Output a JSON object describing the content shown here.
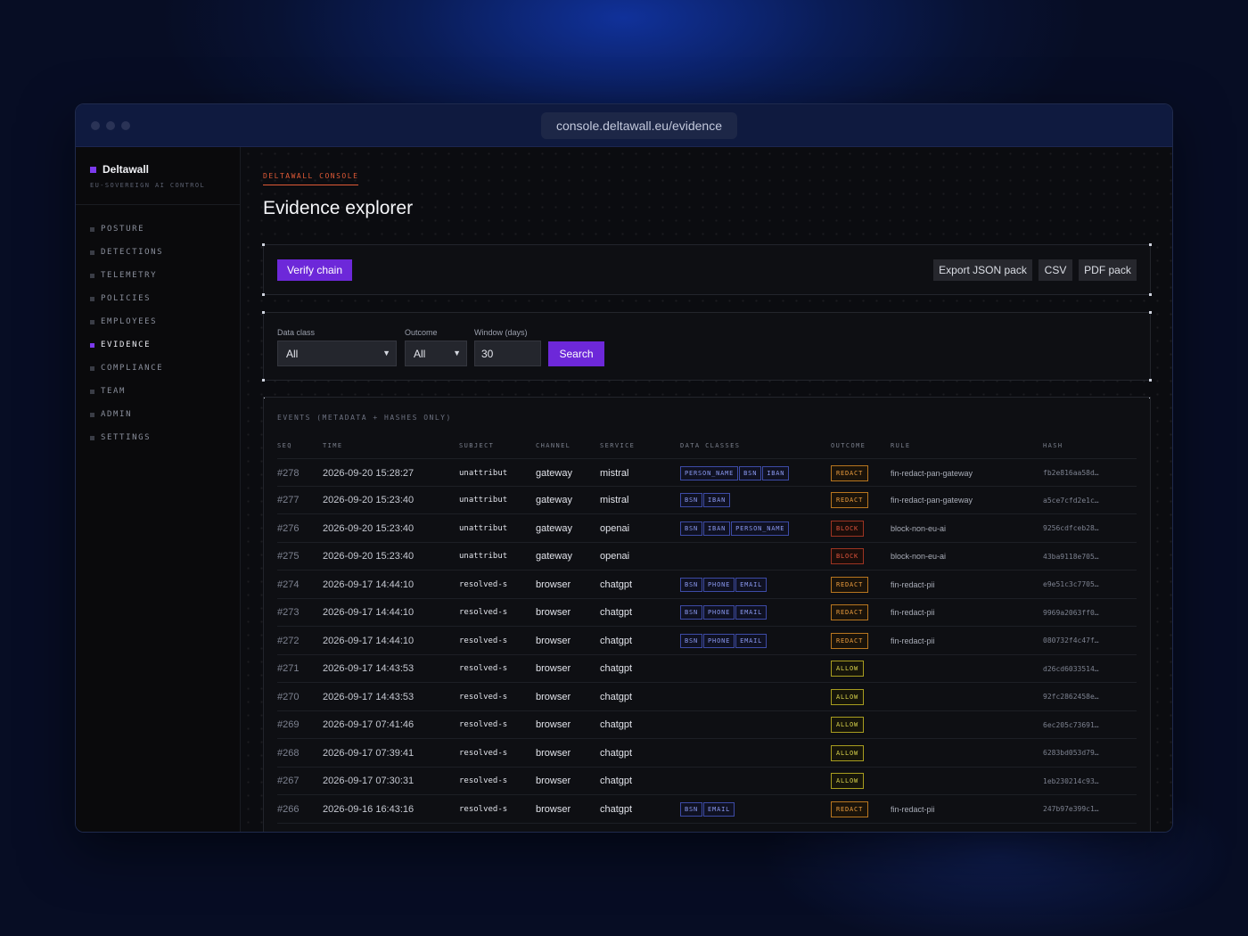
{
  "browser": {
    "url": "console.deltawall.eu/evidence"
  },
  "brand": {
    "name": "Deltawall",
    "tagline": "EU-SOVEREIGN AI CONTROL"
  },
  "nav": [
    {
      "label": "POSTURE",
      "active": false
    },
    {
      "label": "DETECTIONS",
      "active": false
    },
    {
      "label": "TELEMETRY",
      "active": false
    },
    {
      "label": "POLICIES",
      "active": false
    },
    {
      "label": "EMPLOYEES",
      "active": false
    },
    {
      "label": "EVIDENCE",
      "active": true
    },
    {
      "label": "COMPLIANCE",
      "active": false
    },
    {
      "label": "TEAM",
      "active": false
    },
    {
      "label": "ADMIN",
      "active": false
    },
    {
      "label": "SETTINGS",
      "active": false
    }
  ],
  "page": {
    "eyebrow": "DELTAWALL CONSOLE",
    "title": "Evidence explorer"
  },
  "actions": {
    "verify": "Verify chain",
    "export_json": "Export JSON pack",
    "csv": "CSV",
    "pdf": "PDF pack"
  },
  "filters": {
    "data_class": {
      "label": "Data class",
      "value": "All"
    },
    "outcome": {
      "label": "Outcome",
      "value": "All"
    },
    "window": {
      "label": "Window (days)",
      "value": "30"
    },
    "search": "Search"
  },
  "events": {
    "heading": "EVENTS (METADATA + HASHES ONLY)",
    "columns": [
      "SEQ",
      "TIME",
      "SUBJECT",
      "CHANNEL",
      "SERVICE",
      "DATA CLASSES",
      "OUTCOME",
      "RULE",
      "HASH"
    ],
    "rows": [
      {
        "seq": "#278",
        "time": "2026-09-20 15:28:27",
        "subject": "unattribut",
        "channel": "gateway",
        "service": "mistral",
        "classes": [
          "PERSON_NAME",
          "BSN",
          "IBAN"
        ],
        "outcome": "REDACT",
        "rule": "fin-redact-pan-gateway",
        "hash": "fb2e816aa58d…"
      },
      {
        "seq": "#277",
        "time": "2026-09-20 15:23:40",
        "subject": "unattribut",
        "channel": "gateway",
        "service": "mistral",
        "classes": [
          "BSN",
          "IBAN"
        ],
        "outcome": "REDACT",
        "rule": "fin-redact-pan-gateway",
        "hash": "a5ce7cfd2e1c…"
      },
      {
        "seq": "#276",
        "time": "2026-09-20 15:23:40",
        "subject": "unattribut",
        "channel": "gateway",
        "service": "openai",
        "classes": [
          "BSN",
          "IBAN",
          "PERSON_NAME"
        ],
        "outcome": "BLOCK",
        "rule": "block-non-eu-ai",
        "hash": "9256cdfceb28…"
      },
      {
        "seq": "#275",
        "time": "2026-09-20 15:23:40",
        "subject": "unattribut",
        "channel": "gateway",
        "service": "openai",
        "classes": [],
        "outcome": "BLOCK",
        "rule": "block-non-eu-ai",
        "hash": "43ba9118e705…"
      },
      {
        "seq": "#274",
        "time": "2026-09-17 14:44:10",
        "subject": "resolved-s",
        "channel": "browser",
        "service": "chatgpt",
        "classes": [
          "BSN",
          "PHONE",
          "EMAIL"
        ],
        "outcome": "REDACT",
        "rule": "fin-redact-pii",
        "hash": "e9e51c3c7705…"
      },
      {
        "seq": "#273",
        "time": "2026-09-17 14:44:10",
        "subject": "resolved-s",
        "channel": "browser",
        "service": "chatgpt",
        "classes": [
          "BSN",
          "PHONE",
          "EMAIL"
        ],
        "outcome": "REDACT",
        "rule": "fin-redact-pii",
        "hash": "9969a2063ff0…"
      },
      {
        "seq": "#272",
        "time": "2026-09-17 14:44:10",
        "subject": "resolved-s",
        "channel": "browser",
        "service": "chatgpt",
        "classes": [
          "BSN",
          "PHONE",
          "EMAIL"
        ],
        "outcome": "REDACT",
        "rule": "fin-redact-pii",
        "hash": "080732f4c47f…"
      },
      {
        "seq": "#271",
        "time": "2026-09-17 14:43:53",
        "subject": "resolved-s",
        "channel": "browser",
        "service": "chatgpt",
        "classes": [],
        "outcome": "ALLOW",
        "rule": "",
        "hash": "d26cd6033514…"
      },
      {
        "seq": "#270",
        "time": "2026-09-17 14:43:53",
        "subject": "resolved-s",
        "channel": "browser",
        "service": "chatgpt",
        "classes": [],
        "outcome": "ALLOW",
        "rule": "",
        "hash": "92fc2862458e…"
      },
      {
        "seq": "#269",
        "time": "2026-09-17 07:41:46",
        "subject": "resolved-s",
        "channel": "browser",
        "service": "chatgpt",
        "classes": [],
        "outcome": "ALLOW",
        "rule": "",
        "hash": "6ec205c73691…"
      },
      {
        "seq": "#268",
        "time": "2026-09-17 07:39:41",
        "subject": "resolved-s",
        "channel": "browser",
        "service": "chatgpt",
        "classes": [],
        "outcome": "ALLOW",
        "rule": "",
        "hash": "6283bd053d79…"
      },
      {
        "seq": "#267",
        "time": "2026-09-17 07:30:31",
        "subject": "resolved-s",
        "channel": "browser",
        "service": "chatgpt",
        "classes": [],
        "outcome": "ALLOW",
        "rule": "",
        "hash": "1eb230214c93…"
      },
      {
        "seq": "#266",
        "time": "2026-09-16 16:43:16",
        "subject": "resolved-s",
        "channel": "browser",
        "service": "chatgpt",
        "classes": [
          "BSN",
          "EMAIL"
        ],
        "outcome": "REDACT",
        "rule": "fin-redact-pii",
        "hash": "247b97e399c1…"
      }
    ]
  }
}
